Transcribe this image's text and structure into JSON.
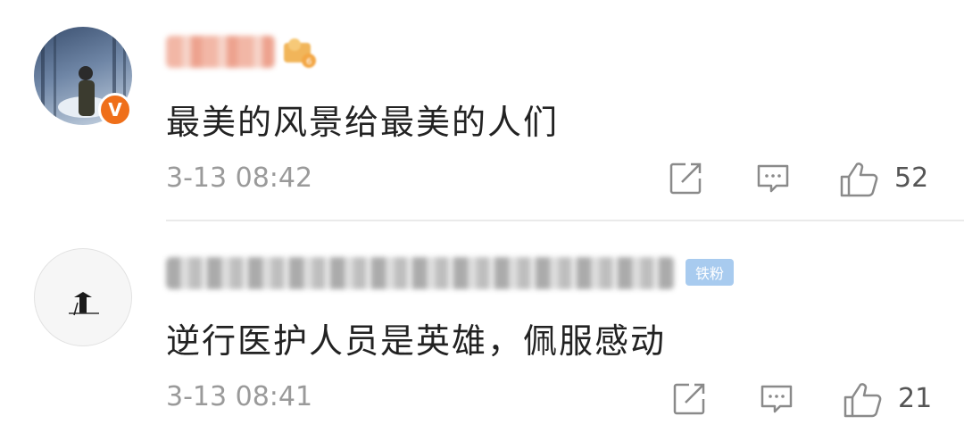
{
  "comments": [
    {
      "avatar_icon": "user-avatar",
      "verified_icon": "verified-v-icon",
      "verified_glyph": "V",
      "level_icon": "member-level-badge",
      "text": "最美的风景给最美的人们",
      "timestamp": "3-13 08:42",
      "share_icon": "share-icon",
      "reply_icon": "comment-icon",
      "like_icon": "thumbs-up-icon",
      "likes": "52"
    },
    {
      "avatar_icon": "user-avatar",
      "fan_badge": "铁粉",
      "text": "逆行医护人员是英雄，佩服感动",
      "timestamp": "3-13 08:41",
      "share_icon": "share-icon",
      "reply_icon": "comment-icon",
      "like_icon": "thumbs-up-icon",
      "likes": "21"
    }
  ],
  "colors": {
    "verified": "#ef6f1a",
    "fan_badge": "#a8cbef",
    "meta_text": "#9a9a9a",
    "icon": "#8a8a8a"
  }
}
